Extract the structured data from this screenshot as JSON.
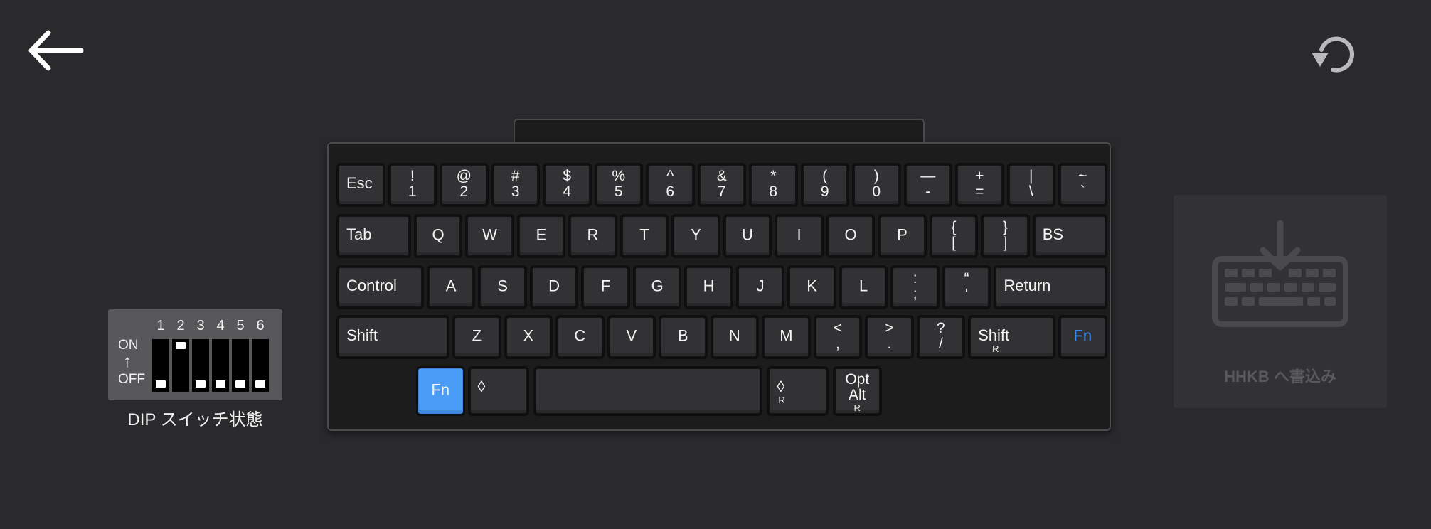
{
  "nav": {
    "back_icon": "arrow-left-icon",
    "undo_icon": "rotate-ccw-icon"
  },
  "dip": {
    "numbers": [
      "1",
      "2",
      "3",
      "4",
      "5",
      "6"
    ],
    "on_label": "ON",
    "arrow": "↑",
    "off_label": "OFF",
    "states": [
      "off",
      "on",
      "off",
      "off",
      "off",
      "off"
    ],
    "caption": "DIP スイッチ状態"
  },
  "keyboard": {
    "rows": [
      [
        {
          "top": "",
          "bottom": "",
          "label": "Esc"
        },
        {
          "top": "!",
          "bottom": "1"
        },
        {
          "top": "@",
          "bottom": "2"
        },
        {
          "top": "#",
          "bottom": "3"
        },
        {
          "top": "$",
          "bottom": "4"
        },
        {
          "top": "%",
          "bottom": "5"
        },
        {
          "top": "^",
          "bottom": "6"
        },
        {
          "top": "&",
          "bottom": "7"
        },
        {
          "top": "*",
          "bottom": "8"
        },
        {
          "top": "(",
          "bottom": "9"
        },
        {
          "top": ")",
          "bottom": "0"
        },
        {
          "top": "—",
          "bottom": "-"
        },
        {
          "top": "+",
          "bottom": "="
        },
        {
          "top": "|",
          "bottom": "\\"
        },
        {
          "top": "~",
          "bottom": "`"
        }
      ],
      [
        {
          "label": "Tab"
        },
        {
          "label": "Q"
        },
        {
          "label": "W"
        },
        {
          "label": "E"
        },
        {
          "label": "R"
        },
        {
          "label": "T"
        },
        {
          "label": "Y"
        },
        {
          "label": "U"
        },
        {
          "label": "I"
        },
        {
          "label": "O"
        },
        {
          "label": "P"
        },
        {
          "top": "{",
          "bottom": "["
        },
        {
          "top": "}",
          "bottom": "]"
        },
        {
          "label": "BS"
        }
      ],
      [
        {
          "label": "Control"
        },
        {
          "label": "A"
        },
        {
          "label": "S"
        },
        {
          "label": "D"
        },
        {
          "label": "F"
        },
        {
          "label": "G"
        },
        {
          "label": "H"
        },
        {
          "label": "J"
        },
        {
          "label": "K"
        },
        {
          "label": "L"
        },
        {
          "top": ":",
          "bottom": ";"
        },
        {
          "top": "“",
          "bottom": "‘"
        },
        {
          "label": "Return"
        }
      ],
      [
        {
          "label": "Shift"
        },
        {
          "label": "Z"
        },
        {
          "label": "X"
        },
        {
          "label": "C"
        },
        {
          "label": "V"
        },
        {
          "label": "B"
        },
        {
          "label": "N"
        },
        {
          "label": "M"
        },
        {
          "top": "<",
          "bottom": ","
        },
        {
          "top": ">",
          "bottom": "."
        },
        {
          "top": "?",
          "bottom": "/"
        },
        {
          "label": "Shift",
          "sub": "R"
        },
        {
          "label": "Fn",
          "variant": "blue"
        }
      ],
      [
        {
          "label": "Fn",
          "variant": "active"
        },
        {
          "label": "◊"
        },
        {
          "label": ""
        },
        {
          "label": "◊",
          "sub": "R"
        },
        {
          "top": "Opt",
          "bottom": "Alt",
          "sub": "R"
        }
      ]
    ]
  },
  "write": {
    "icon": "keyboard-download-icon",
    "label": "HHKB へ書込み"
  }
}
